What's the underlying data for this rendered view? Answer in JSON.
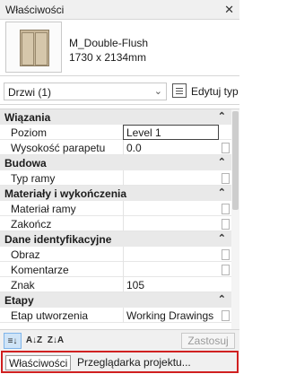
{
  "window": {
    "title": "Właściwości",
    "close_glyph": "✕"
  },
  "type_selector": {
    "name": "M_Double-Flush",
    "size": "1730 x 2134mm",
    "thumbnail_icon": "double-door-icon"
  },
  "instance": {
    "selected": "Drzwi (1)",
    "edit_type_label": "Edytuj typ"
  },
  "properties": {
    "categories": [
      {
        "label": "Wiązania",
        "collapse_glyph": "⌃",
        "params": [
          {
            "label": "Poziom",
            "value": "Level 1"
          },
          {
            "label": "Wysokość parapetu",
            "value": "0.0"
          }
        ]
      },
      {
        "label": "Budowa",
        "collapse_glyph": "⌃",
        "params": [
          {
            "label": "Typ ramy",
            "value": ""
          }
        ]
      },
      {
        "label": "Materiały i wykończenia",
        "collapse_glyph": "⌃",
        "params": [
          {
            "label": "Materiał ramy",
            "value": ""
          },
          {
            "label": "Zakończ",
            "value": ""
          }
        ]
      },
      {
        "label": "Dane identyfikacyjne",
        "collapse_glyph": "⌃",
        "params": [
          {
            "label": "Obraz",
            "value": ""
          },
          {
            "label": "Komentarze",
            "value": ""
          },
          {
            "label": "Znak",
            "value": "105"
          }
        ]
      },
      {
        "label": "Etapy",
        "collapse_glyph": "⌃",
        "params": [
          {
            "label": "Etap utworzenia",
            "value": "Working Drawings"
          }
        ]
      }
    ]
  },
  "toolbar": {
    "sort_buttons": [
      {
        "glyph": "≡↓",
        "icon": "sort-categorized-icon",
        "active": true
      },
      {
        "glyph": "A↓Z",
        "icon": "sort-ascending-icon",
        "active": false
      },
      {
        "glyph": "Z↓A",
        "icon": "sort-descending-icon",
        "active": false
      }
    ],
    "apply_label": "Zastosuj"
  },
  "tabs": [
    {
      "label": "Właściwości",
      "active": true
    },
    {
      "label": "Przeglądarka projektu...",
      "active": false
    }
  ],
  "colors": {
    "highlight_border": "#d02020",
    "category_bg": "#e9e9e9"
  }
}
